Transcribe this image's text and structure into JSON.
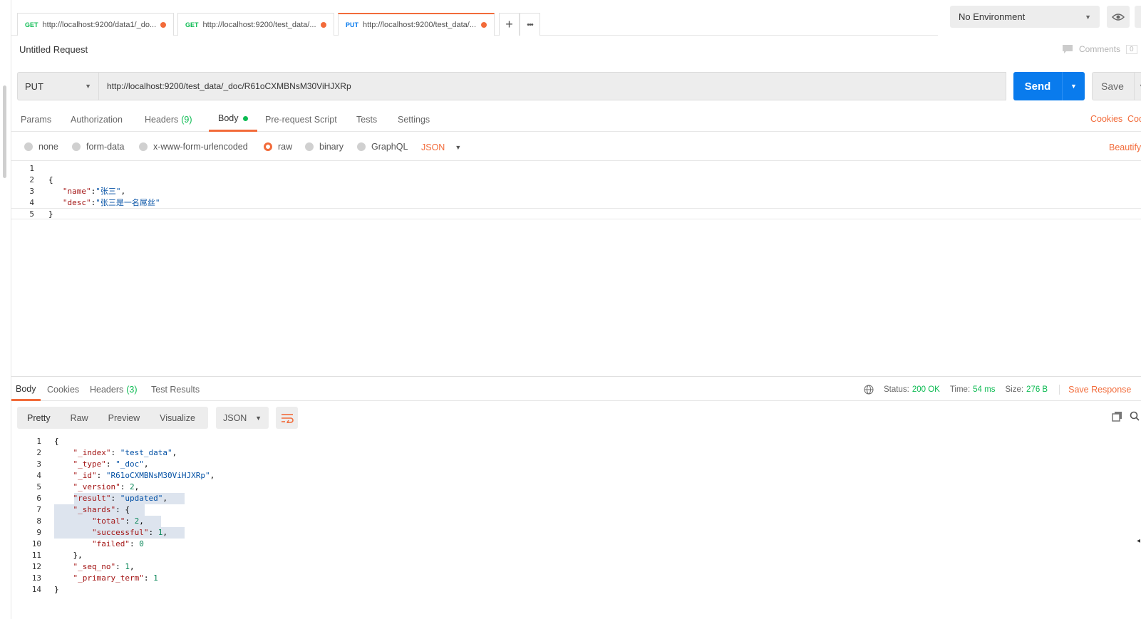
{
  "tabs": [
    {
      "method": "GET",
      "url": "http://localhost:9200/data1/_do..."
    },
    {
      "method": "GET",
      "url": "http://localhost:9200/test_data/..."
    },
    {
      "method": "PUT",
      "url": "http://localhost:9200/test_data/..."
    }
  ],
  "tab_actions": {
    "add": "+",
    "more": "•••"
  },
  "environment": {
    "selected": "No Environment"
  },
  "request": {
    "title": "Untitled Request",
    "comments_label": "Comments",
    "comments_count": "0",
    "method": "PUT",
    "url": "http://localhost:9200/test_data/_doc/R61oCXMBNsM30ViHJXRp",
    "send_label": "Send",
    "save_label": "Save"
  },
  "request_tabs": {
    "params": "Params",
    "authorization": "Authorization",
    "headers": "Headers",
    "headers_count": "(9)",
    "body": "Body",
    "prerequest": "Pre-request Script",
    "tests": "Tests",
    "settings": "Settings",
    "cookies": "Cookies",
    "code": "Code"
  },
  "body_types": {
    "none": "none",
    "form_data": "form-data",
    "urlencoded": "x-www-form-urlencoded",
    "raw": "raw",
    "binary": "binary",
    "graphql": "GraphQL",
    "format": "JSON",
    "beautify": "Beautify"
  },
  "request_body": {
    "line_numbers": [
      "1",
      "2",
      "3",
      "4",
      "5"
    ],
    "open": "{",
    "name_key": "\"name\"",
    "name_val": "\"张三\"",
    "desc_key": "\"desc\"",
    "desc_val": "\"张三是一名屌丝\"",
    "close": "}"
  },
  "response_tabs": {
    "body": "Body",
    "cookies": "Cookies",
    "headers": "Headers",
    "headers_count": "(3)",
    "test_results": "Test Results"
  },
  "response_status": {
    "status_label": "Status:",
    "status_value": "200 OK",
    "time_label": "Time:",
    "time_value": "54 ms",
    "size_label": "Size:",
    "size_value": "276 B",
    "save_response": "Save Response"
  },
  "response_view": {
    "pretty": "Pretty",
    "raw": "Raw",
    "preview": "Preview",
    "visualize": "Visualize",
    "format": "JSON"
  },
  "response_body": {
    "index_key": "\"_index\"",
    "index_val": "\"test_data\"",
    "type_key": "\"_type\"",
    "type_val": "\"_doc\"",
    "id_key": "\"_id\"",
    "id_val": "\"R61oCXMBNsM30ViHJXRp\"",
    "version_key": "\"_version\"",
    "version_val": "2",
    "result_key": "\"result\"",
    "result_val": "\"updated\"",
    "shards_key": "\"_shards\"",
    "total_key": "\"total\"",
    "total_val": "2",
    "successful_key": "\"successful\"",
    "successful_val": "1",
    "failed_key": "\"failed\"",
    "failed_val": "0",
    "seq_key": "\"_seq_no\"",
    "seq_val": "1",
    "term_key": "\"_primary_term\"",
    "term_val": "1"
  },
  "colors": {
    "accent": "#f26b3a",
    "send": "#097bed",
    "success": "#0cbb52"
  }
}
